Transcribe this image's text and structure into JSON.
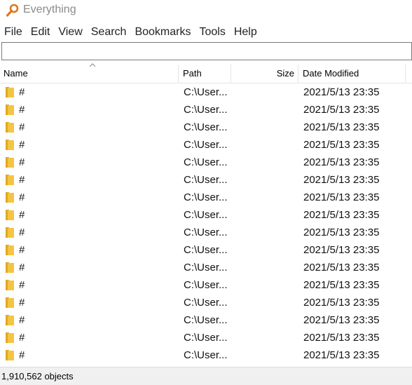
{
  "window": {
    "title": "Everything",
    "app_icon": "magnifier-icon",
    "accent": "#e0781c"
  },
  "menu": {
    "items": [
      "File",
      "Edit",
      "View",
      "Search",
      "Bookmarks",
      "Tools",
      "Help"
    ]
  },
  "search": {
    "value": "",
    "placeholder": ""
  },
  "table": {
    "columns": {
      "name": "Name",
      "path": "Path",
      "size": "Size",
      "date_modified": "Date Modified"
    },
    "sort_column": "Name",
    "sort_direction": "ascending",
    "folder_icon": "folder-icon",
    "folder_color": "#f4c542",
    "rows": [
      {
        "name": "#",
        "path": "C:\\User...",
        "size": "",
        "date": "2021/5/13 23:35"
      },
      {
        "name": "#",
        "path": "C:\\User...",
        "size": "",
        "date": "2021/5/13 23:35"
      },
      {
        "name": "#",
        "path": "C:\\User...",
        "size": "",
        "date": "2021/5/13 23:35"
      },
      {
        "name": "#",
        "path": "C:\\User...",
        "size": "",
        "date": "2021/5/13 23:35"
      },
      {
        "name": "#",
        "path": "C:\\User...",
        "size": "",
        "date": "2021/5/13 23:35"
      },
      {
        "name": "#",
        "path": "C:\\User...",
        "size": "",
        "date": "2021/5/13 23:35"
      },
      {
        "name": "#",
        "path": "C:\\User...",
        "size": "",
        "date": "2021/5/13 23:35"
      },
      {
        "name": "#",
        "path": "C:\\User...",
        "size": "",
        "date": "2021/5/13 23:35"
      },
      {
        "name": "#",
        "path": "C:\\User...",
        "size": "",
        "date": "2021/5/13 23:35"
      },
      {
        "name": "#",
        "path": "C:\\User...",
        "size": "",
        "date": "2021/5/13 23:35"
      },
      {
        "name": "#",
        "path": "C:\\User...",
        "size": "",
        "date": "2021/5/13 23:35"
      },
      {
        "name": "#",
        "path": "C:\\User...",
        "size": "",
        "date": "2021/5/13 23:35"
      },
      {
        "name": "#",
        "path": "C:\\User...",
        "size": "",
        "date": "2021/5/13 23:35"
      },
      {
        "name": "#",
        "path": "C:\\User...",
        "size": "",
        "date": "2021/5/13 23:35"
      },
      {
        "name": "#",
        "path": "C:\\User...",
        "size": "",
        "date": "2021/5/13 23:35"
      },
      {
        "name": "#",
        "path": "C:\\User...",
        "size": "",
        "date": "2021/5/13 23:35"
      }
    ]
  },
  "status": {
    "text": "1,910,562 objects"
  }
}
